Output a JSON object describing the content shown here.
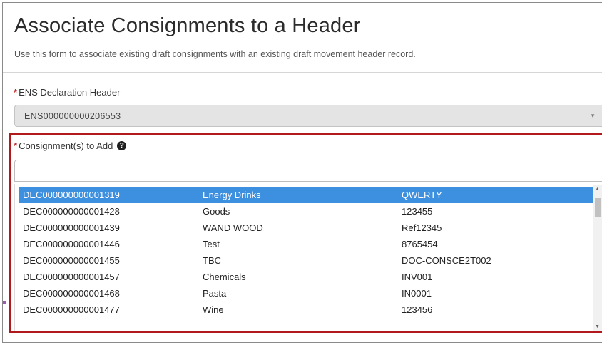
{
  "page": {
    "title": "Associate Consignments to a Header",
    "subtitle": "Use this form to associate existing draft consignments with an existing draft movement header record."
  },
  "ens_header": {
    "required_mark": "*",
    "label": "ENS Declaration Header",
    "value": "ENS000000000206553",
    "caret_icon": "chevron-down-icon"
  },
  "consignments": {
    "required_mark": "*",
    "label": "Consignment(s) to Add",
    "help_icon": "question-circle-icon",
    "help_glyph": "?",
    "search_value": "",
    "options": [
      {
        "id": "DEC000000000001319",
        "description": "Energy Drinks",
        "reference": "QWERTY",
        "selected": true
      },
      {
        "id": "DEC000000000001428",
        "description": "Goods",
        "reference": "123455",
        "selected": false
      },
      {
        "id": "DEC000000000001439",
        "description": "WAND WOOD",
        "reference": "Ref12345",
        "selected": false
      },
      {
        "id": "DEC000000000001446",
        "description": "Test",
        "reference": "8765454",
        "selected": false
      },
      {
        "id": "DEC000000000001455",
        "description": "TBC",
        "reference": "DOC-CONSCE2T002",
        "selected": false
      },
      {
        "id": "DEC000000000001457",
        "description": "Chemicals",
        "reference": "INV001",
        "selected": false
      },
      {
        "id": "DEC000000000001468",
        "description": "Pasta",
        "reference": "IN0001",
        "selected": false
      },
      {
        "id": "DEC000000000001477",
        "description": "Wine",
        "reference": "123456",
        "selected": false
      }
    ]
  },
  "colors": {
    "highlight_border": "#b2191d",
    "selected_row": "#3d8fe0",
    "required": "#c9302c"
  }
}
